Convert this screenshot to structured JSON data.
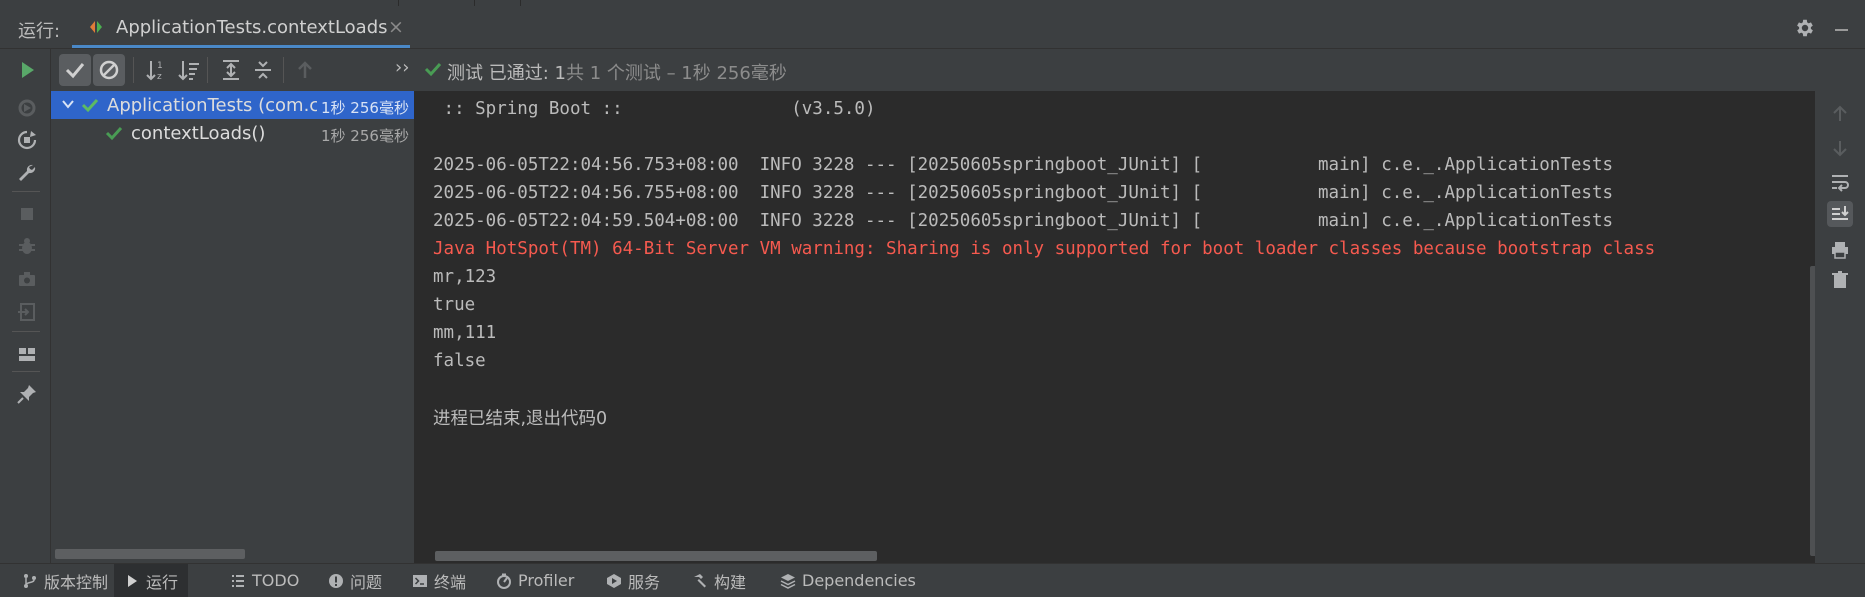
{
  "header": {
    "panel_label": "运行:",
    "tab_title": "ApplicationTests.contextLoads",
    "close_glyph": "×"
  },
  "toolbar": {
    "icons": [
      "rerun-icon",
      "show-passed-icon",
      "show-ignored-icon",
      "sort-alpha-icon",
      "sort-duration-icon",
      "expand-all-icon",
      "collapse-all-icon",
      "previous-failed-icon",
      "more-icon"
    ],
    "more_glyph": "››",
    "status_prefix": "测试 已通过: 1",
    "status_suffix": "共 1 个测试 – 1秒 256毫秒"
  },
  "tree": {
    "items": [
      {
        "label": "ApplicationTests (com.c",
        "time": "1秒 256毫秒",
        "selected": true,
        "status": "passed"
      },
      {
        "label": "contextLoads()",
        "time": "1秒 256毫秒",
        "selected": false,
        "status": "passed"
      }
    ]
  },
  "console": {
    "lines": [
      {
        "text": " :: Spring Boot ::                (v3.5.0)",
        "kind": "normal"
      },
      {
        "text": "",
        "kind": "normal"
      },
      {
        "text": "2025-06-05T22:04:56.753+08:00  INFO 3228 --- [20250605springboot_JUnit] [           main] c.e._.ApplicationTests",
        "kind": "normal"
      },
      {
        "text": "2025-06-05T22:04:56.755+08:00  INFO 3228 --- [20250605springboot_JUnit] [           main] c.e._.ApplicationTests",
        "kind": "normal"
      },
      {
        "text": "2025-06-05T22:04:59.504+08:00  INFO 3228 --- [20250605springboot_JUnit] [           main] c.e._.ApplicationTests",
        "kind": "normal"
      },
      {
        "text": "Java HotSpot(TM) 64-Bit Server VM warning: Sharing is only supported for boot loader classes because bootstrap class",
        "kind": "error"
      },
      {
        "text": "mr,123",
        "kind": "normal"
      },
      {
        "text": "true",
        "kind": "normal"
      },
      {
        "text": "mm,111",
        "kind": "normal"
      },
      {
        "text": "false",
        "kind": "normal"
      },
      {
        "text": "",
        "kind": "normal"
      },
      {
        "text": "进程已结束,退出代码0",
        "kind": "normal"
      }
    ]
  },
  "bottom_bar": {
    "items": [
      {
        "label": "版本控制",
        "icon": "vcs-branch-icon"
      },
      {
        "label": "运行",
        "icon": "run-icon",
        "active": true
      },
      {
        "label": "TODO",
        "icon": "todo-list-icon"
      },
      {
        "label": "问题",
        "icon": "problems-icon"
      },
      {
        "label": "终端",
        "icon": "terminal-icon"
      },
      {
        "label": "Profiler",
        "icon": "profiler-icon"
      },
      {
        "label": "服务",
        "icon": "services-icon"
      },
      {
        "label": "构建",
        "icon": "build-hammer-icon"
      },
      {
        "label": "Dependencies",
        "icon": "dependencies-icon"
      }
    ]
  },
  "colors": {
    "accent": "#4a88c7",
    "selection": "#2f65ca",
    "success": "#499c54",
    "error_text": "#f65a4f",
    "run_green": "#59a869"
  }
}
